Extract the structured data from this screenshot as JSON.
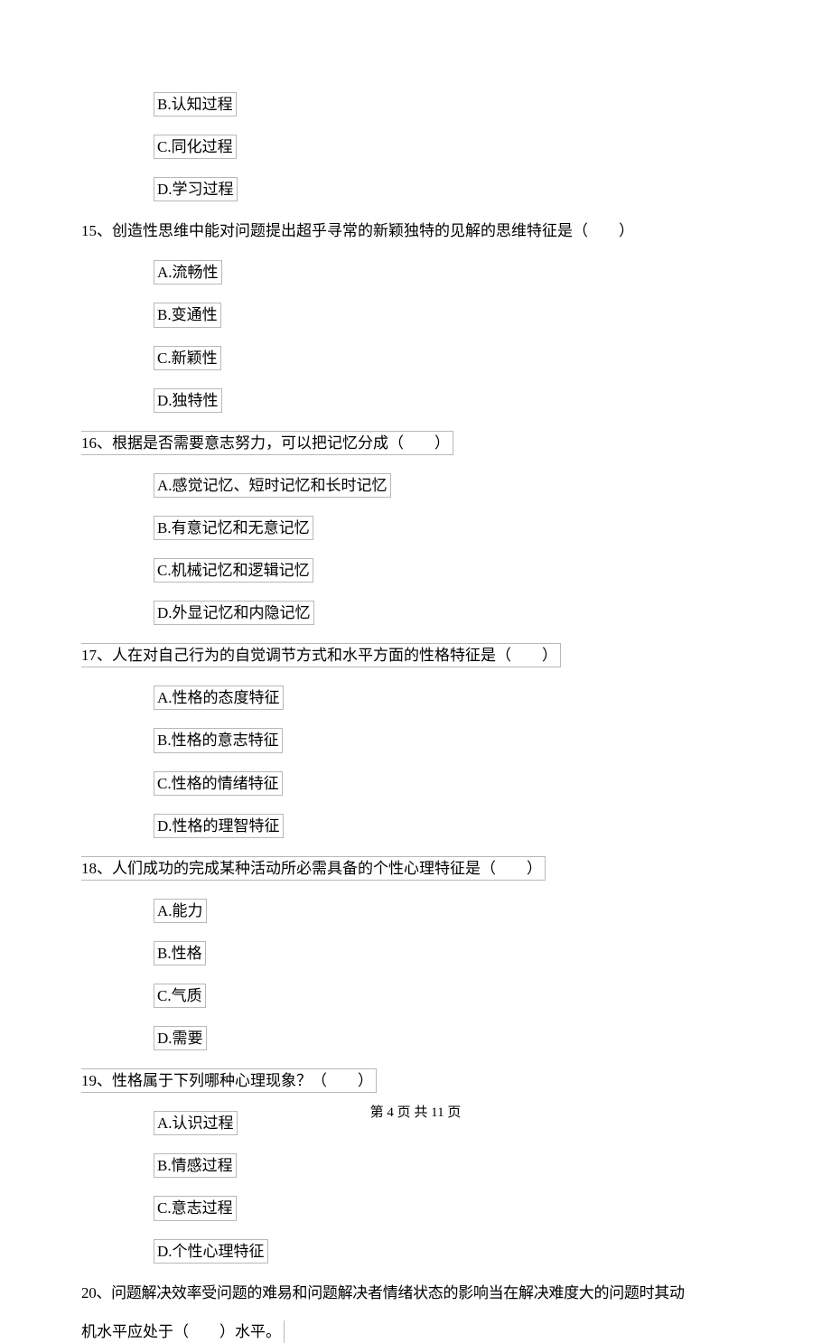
{
  "q14_options": {
    "b": "B.认知过程",
    "c": "C.同化过程",
    "d": "D.学习过程"
  },
  "q15": {
    "stem": "15、创造性思维中能对问题提出超乎寻常的新颖独特的见解的思维特征是（　　）",
    "a": "A.流畅性",
    "b": "B.变通性",
    "c": "C.新颖性",
    "d": "D.独特性"
  },
  "q16": {
    "stem": "16、根据是否需要意志努力，可以把记忆分成（　　）",
    "a": "A.感觉记忆、短时记忆和长时记忆",
    "b": "B.有意记忆和无意记忆",
    "c": "C.机械记忆和逻辑记忆",
    "d": "D.外显记忆和内隐记忆"
  },
  "q17": {
    "stem": "17、人在对自己行为的自觉调节方式和水平方面的性格特征是（　　）",
    "a": "A.性格的态度特征",
    "b": "B.性格的意志特征",
    "c": "C.性格的情绪特征",
    "d": "D.性格的理智特征"
  },
  "q18": {
    "stem": "18、人们成功的完成某种活动所必需具备的个性心理特征是（　　）",
    "a": "A.能力",
    "b": "B.性格",
    "c": "C.气质",
    "d": "D.需要"
  },
  "q19": {
    "stem": "19、性格属于下列哪种心理现象？（　　）",
    "a": "A.认识过程",
    "b": "B.情感过程",
    "c": "C.意志过程",
    "d": "D.个性心理特征"
  },
  "q20": {
    "line1": "20、问题解决效率受问题的难易和问题解决者情绪状态的影响当在解决难度大的问题时其动",
    "line2": "机水平应处于（　　）水平。"
  },
  "footer": "第 4 页 共 11 页"
}
